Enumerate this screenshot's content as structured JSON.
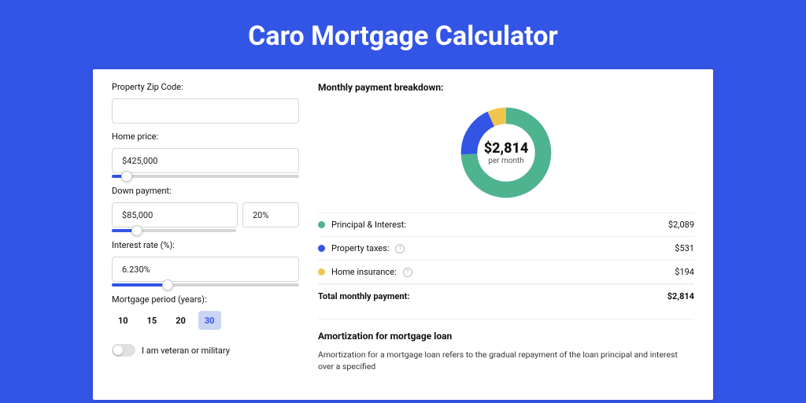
{
  "title": "Caro Mortgage Calculator",
  "left": {
    "zip_label": "Property Zip Code:",
    "zip_value": "",
    "price_label": "Home price:",
    "price_value": "$425,000",
    "price_slider_pct": 8,
    "down_label": "Down payment:",
    "down_value": "$85,000",
    "down_pct_value": "20%",
    "down_slider_pct": 20,
    "rate_label": "Interest rate (%):",
    "rate_value": "6.230%",
    "rate_slider_pct": 30,
    "period_label": "Mortgage period (years):",
    "periods": [
      "10",
      "15",
      "20",
      "30"
    ],
    "period_active_index": 3,
    "vet_label": "I am veteran or military"
  },
  "right": {
    "breakdown_title": "Monthly payment breakdown:",
    "donut_amount": "$2,814",
    "donut_sub": "per month",
    "lines": [
      {
        "dot": "#4eb38f",
        "label": "Principal & Interest:",
        "help": false,
        "value": "$2,089"
      },
      {
        "dot": "#3355e6",
        "label": "Property taxes:",
        "help": true,
        "value": "$531"
      },
      {
        "dot": "#f0c64e",
        "label": "Home insurance:",
        "help": true,
        "value": "$194"
      }
    ],
    "total_label": "Total monthly payment:",
    "total_value": "$2,814",
    "amort_title": "Amortization for mortgage loan",
    "amort_body": "Amortization for a mortgage loan refers to the gradual repayment of the loan principal and interest over a specified"
  },
  "chart_data": {
    "type": "pie",
    "title": "Monthly payment breakdown",
    "series": [
      {
        "name": "Principal & Interest",
        "value": 2089,
        "color": "#4eb38f"
      },
      {
        "name": "Property taxes",
        "value": 531,
        "color": "#3355e6"
      },
      {
        "name": "Home insurance",
        "value": 194,
        "color": "#f0c64e"
      }
    ],
    "total": 2814
  }
}
